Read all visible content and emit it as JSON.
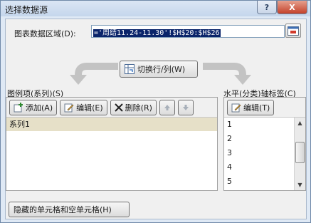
{
  "window": {
    "title": "选择数据源",
    "help_label": "?",
    "close_label": "X"
  },
  "range": {
    "label": "图表数据区域(D):",
    "value": "='周结11.24-11.30'!$H$20:$H$26"
  },
  "switch_button": {
    "label": "切换行/列(W)"
  },
  "series": {
    "section_label": "图例项(系列)(S)",
    "add_label": "添加(A)",
    "edit_label": "编辑(E)",
    "delete_label": "删除(R)",
    "items": [
      "系列1"
    ]
  },
  "axis": {
    "section_label": "水平(分类)轴标签(C)",
    "edit_label": "编辑(T)",
    "items": [
      "1",
      "2",
      "3",
      "4",
      "5"
    ]
  },
  "hidden_cells_button": {
    "label": "隐藏的单元格和空单元格(H)"
  },
  "icons": {
    "collapse": "collapse-range-icon",
    "switch": "switch-row-column-icon",
    "add": "add-icon",
    "edit": "edit-icon",
    "delete": "delete-icon",
    "move_up": "move-up-icon",
    "move_down": "move-down-icon"
  },
  "colors": {
    "selection": "#0a246a",
    "selected_row": "#e6e0c8",
    "title_bar": "#c5d6ec",
    "close_button": "#c3412a"
  }
}
